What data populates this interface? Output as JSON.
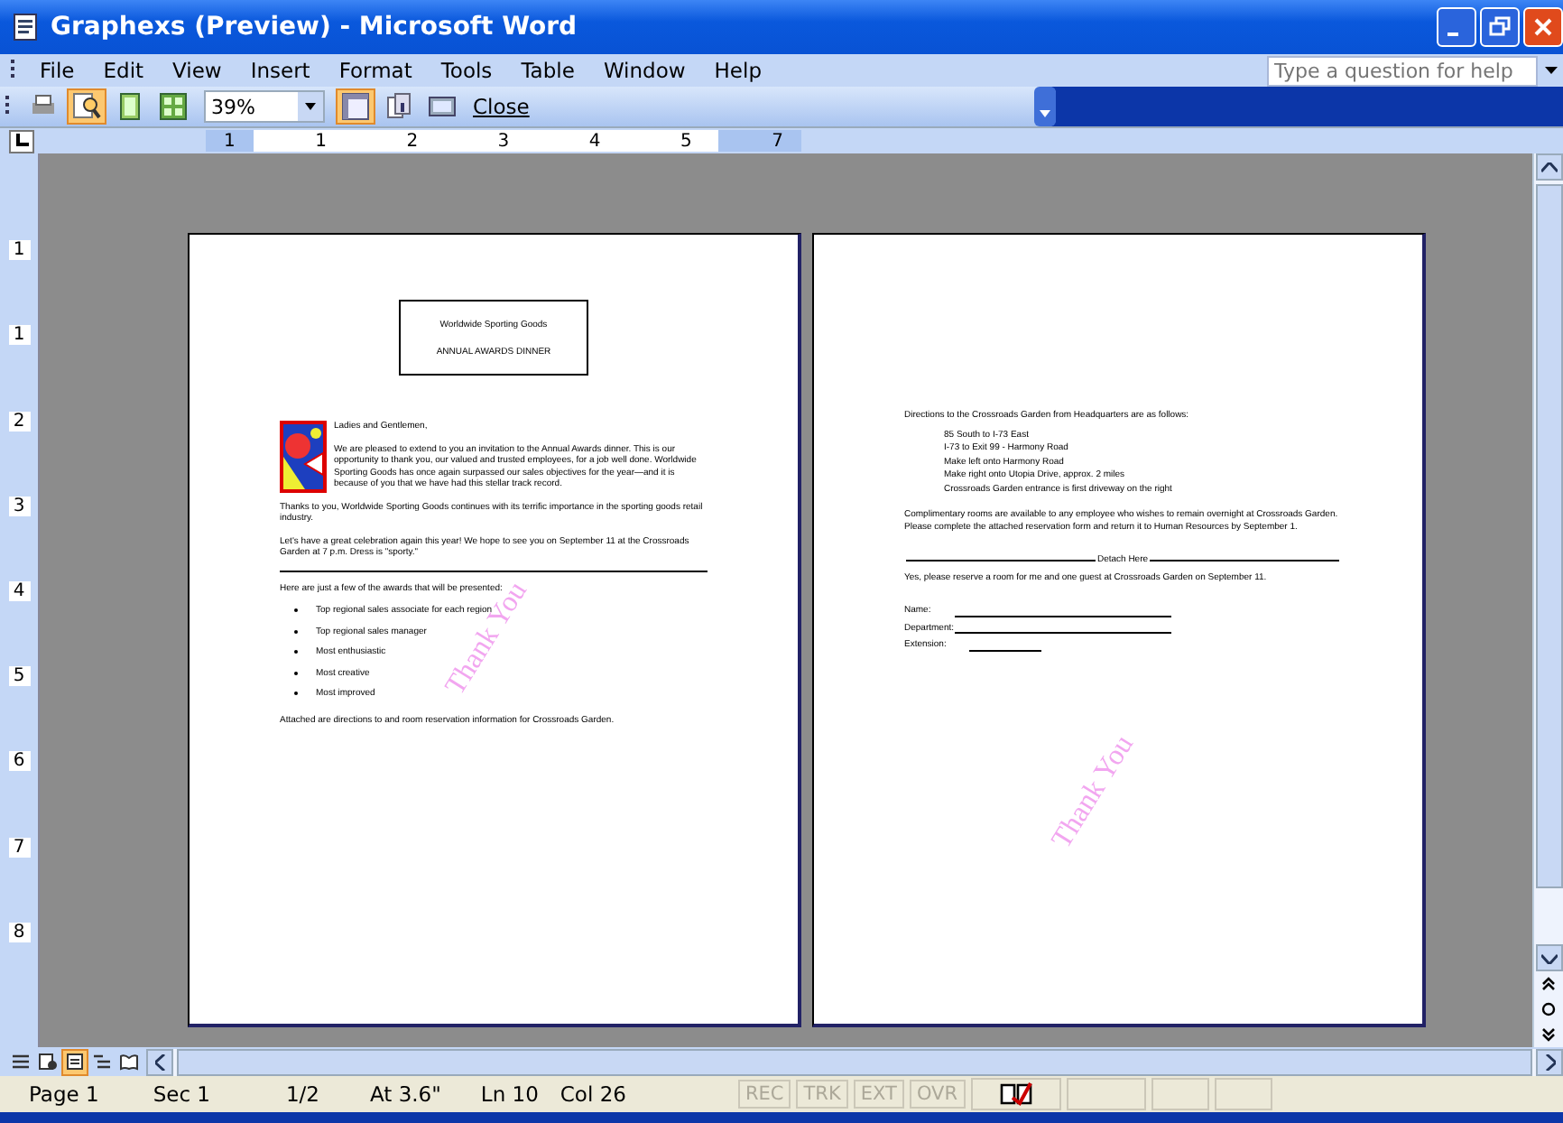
{
  "window": {
    "title": "Graphexs (Preview) - Microsoft Word"
  },
  "menu": [
    {
      "label": "File"
    },
    {
      "label": "Edit"
    },
    {
      "label": "View"
    },
    {
      "label": "Insert"
    },
    {
      "label": "Format"
    },
    {
      "label": "Tools"
    },
    {
      "label": "Table"
    },
    {
      "label": "Window"
    },
    {
      "label": "Help"
    }
  ],
  "help_search": {
    "placeholder": "Type a question for help"
  },
  "toolbar": {
    "before_zoom": [
      {
        "kind": "print",
        "selected": false
      },
      {
        "kind": "magnifier",
        "selected": true
      },
      {
        "kind": "one_page",
        "selected": false
      },
      {
        "kind": "multiple_pages",
        "selected": false
      }
    ],
    "zoom": "39%",
    "after_zoom": [
      {
        "kind": "ruler",
        "selected": true
      },
      {
        "kind": "shrink",
        "selected": false
      },
      {
        "kind": "full_screen",
        "selected": false
      }
    ],
    "close": "Close"
  },
  "ruler": {
    "labels": [
      "1",
      "1",
      "2",
      "3",
      "4",
      "5",
      "7"
    ]
  },
  "vertical_ruler": {
    "labels": [
      "1",
      "1",
      "2",
      "3",
      "4",
      "5",
      "6",
      "7",
      "8"
    ]
  },
  "pages": [
    {
      "kind": "letter",
      "watermark": "Thank You",
      "heading": [
        "Worldwide Sporting Goods",
        "ANNUAL AWARDS DINNER"
      ],
      "salutation": "Ladies and Gentlemen,",
      "paragraphs": [
        "We are pleased to extend to you an invitation to the Annual Awards dinner.  This is our opportunity to thank you, our valued and trusted employees, for a job well done. Worldwide Sporting Goods has once again surpassed our sales objectives for the year—and it is because of you that we have had this stellar track record.",
        "Thanks to you, Worldwide Sporting Goods continues with its terrific importance in the sporting goods retail industry.",
        "Let's have a great celebration again this year! We hope to see you on September 11 at the Crossroads Garden at 7 p.m. Dress is \"sporty.\""
      ],
      "list_intro": "Here are just a few of the awards that will be presented:",
      "bullets": [
        "Top regional sales associate for each region",
        "Top regional sales manager",
        "Most enthusiastic",
        "Most creative",
        "Most improved"
      ],
      "closing": "Attached are directions to and room reservation information for Crossroads Garden."
    },
    {
      "kind": "form",
      "watermark": "Thank You",
      "intro": "Directions to the Crossroads Garden from Headquarters are as follows:",
      "directions": [
        "85 South to I-73 East",
        "I-73 to Exit 99 - Harmony Road",
        "Make left onto Harmony Road",
        "Make right onto Utopia Drive, approx. 2 miles",
        "Crossroads Garden entrance is first driveway on the right"
      ],
      "note": "Complimentary rooms are available to any employee who wishes to remain overnight at Crossroads Garden. Please complete the attached reservation form and return it to Human Resources by September 1.",
      "detach": "Detach Here",
      "reply": "Yes, please reserve a room for me and one guest at Crossroads Garden on September 11.",
      "fields": [
        {
          "label": "Name:",
          "kind": "long"
        },
        {
          "label": "Department:",
          "kind": "long"
        },
        {
          "label": "Extension:",
          "kind": "short"
        }
      ]
    }
  ],
  "view_buttons": [
    {
      "kind": "normal",
      "selected": false
    },
    {
      "kind": "web",
      "selected": false
    },
    {
      "kind": "print",
      "selected": true
    },
    {
      "kind": "outline",
      "selected": false
    },
    {
      "kind": "reading",
      "selected": false
    }
  ],
  "status_bar": {
    "fields": [
      {
        "text": "Page 1"
      },
      {
        "text": "Sec 1"
      },
      {
        "text": "1/2"
      },
      {
        "text": "At 3.6\""
      },
      {
        "text": "Ln 10"
      },
      {
        "text": "Col 26"
      }
    ],
    "modes": [
      {
        "label": "REC",
        "disabled": true
      },
      {
        "label": "TRK",
        "disabled": true
      },
      {
        "label": "EXT",
        "disabled": true
      },
      {
        "label": "OVR",
        "disabled": true
      }
    ]
  }
}
